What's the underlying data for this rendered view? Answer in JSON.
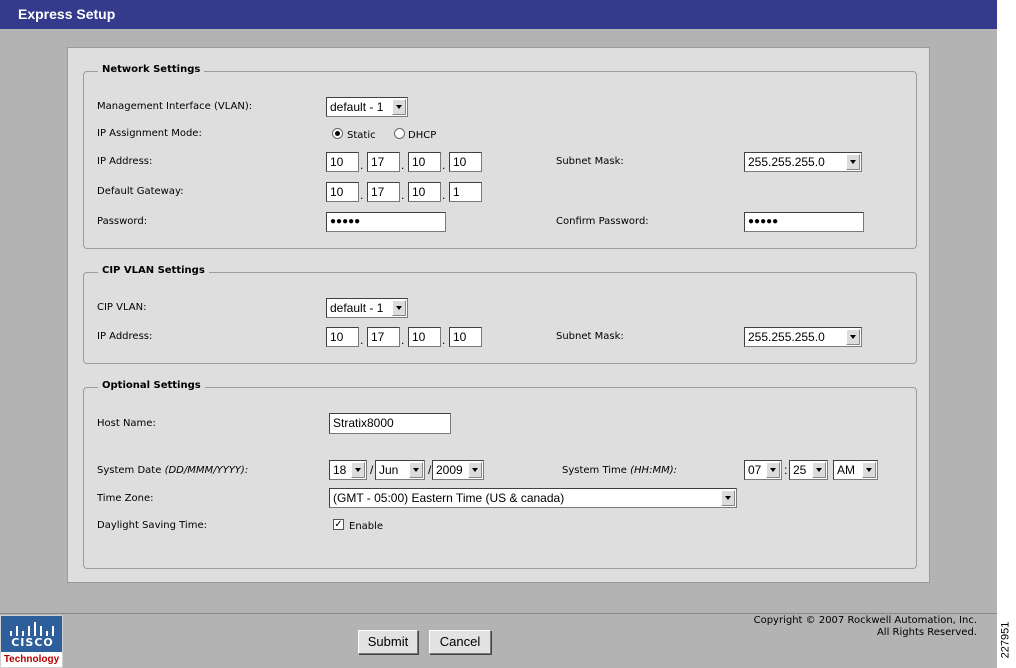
{
  "window": {
    "title": "Express Setup"
  },
  "network": {
    "legend": "Network Settings",
    "mgmt_label": "Management Interface (VLAN):",
    "mgmt_value": "default - 1",
    "ipmode_label": "IP Assignment Mode:",
    "static_label": "Static",
    "dhcp_label": "DHCP",
    "ip_label": "IP Address:",
    "ip": [
      "10",
      "17",
      "10",
      "10"
    ],
    "subnet_label": "Subnet Mask:",
    "subnet_value": "255.255.255.0",
    "gateway_label": "Default Gateway:",
    "gateway": [
      "10",
      "17",
      "10",
      "1"
    ],
    "password_label": "Password:",
    "password_mask": "●●●●●",
    "confirm_label": "Confirm Password:",
    "confirm_mask": "●●●●●"
  },
  "cip": {
    "legend": "CIP VLAN Settings",
    "vlan_label": "CIP VLAN:",
    "vlan_value": "default - 1",
    "ip_label": "IP Address:",
    "ip": [
      "10",
      "17",
      "10",
      "10"
    ],
    "subnet_label": "Subnet Mask:",
    "subnet_value": "255.255.255.0"
  },
  "optional": {
    "legend": "Optional Settings",
    "host_label": "Host Name:",
    "host_value": "Stratix8000",
    "date_label": "System Date",
    "date_hint": "(DD/MMM/YYYY):",
    "day": "18",
    "month": "Jun",
    "year": "2009",
    "date_sep": "/",
    "time_label": "System Time",
    "time_hint": "(HH:MM):",
    "hour": "07",
    "minute": "25",
    "ampm": "AM",
    "time_sep": ":",
    "tz_label": "Time Zone:",
    "tz_value": "(GMT - 05:00) Eastern Time (US & canada)",
    "dst_label": "Daylight Saving Time:",
    "dst_enable": "Enable",
    "dst_checked": true
  },
  "ip_dot": ".",
  "footer": {
    "submit": "Submit",
    "cancel": "Cancel",
    "copyright1": "Copyright © 2007 Rockwell Automation, Inc.",
    "copyright2": "All Rights Reserved.",
    "logo_name": "CISCO",
    "logo_tag": "Technology",
    "side_id": "227951"
  },
  "colors": {
    "titlebar": "#343a8c",
    "background": "#b3b3b3",
    "panel": "#dedede",
    "logo": "#2f5f9b"
  }
}
